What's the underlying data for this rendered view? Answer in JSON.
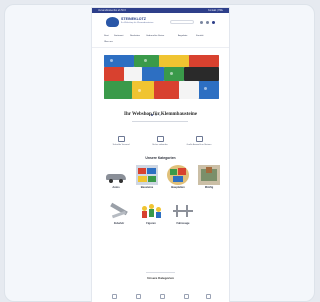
{
  "topbar": {
    "left_text": "Versandkostenfrei ab 50 €",
    "right_text": "Kontakt | Hilfe"
  },
  "brand": {
    "name": "STEINEKLOTZ",
    "tagline": "Ihr Webshop für Klemmbausteine"
  },
  "nav": {
    "items": [
      "Start",
      "Sortiment",
      "Neuheiten",
      "Gebrauchte Steine",
      "Angebote",
      "Kontakt",
      "Über uns"
    ]
  },
  "hero": {
    "slides_total": 3,
    "active_slide": 1,
    "colors": {
      "red": "#d8412f",
      "green": "#3a9a4a",
      "yellow": "#f0c431",
      "blue": "#2d6fc2",
      "white": "#f4f4f4",
      "black": "#2a2a2a"
    }
  },
  "headline": "Ihr Webshop für Klemmbausteine",
  "usps": [
    {
      "icon": "truck-icon",
      "text": "Schneller Versand"
    },
    {
      "icon": "shield-icon",
      "text": "Sicher einkaufen"
    },
    {
      "icon": "box-icon",
      "text": "Große Auswahl an Steinen"
    }
  ],
  "categories_title": "Unsere Kategorien",
  "categories": [
    {
      "label": "Autos"
    },
    {
      "label": "Bausteine"
    },
    {
      "label": "Bauplatten"
    },
    {
      "label": "Minifig"
    },
    {
      "label": "Zubehör"
    },
    {
      "label": "Figuren"
    },
    {
      "label": "Fahrzeuge"
    }
  ],
  "footer": {
    "title": "Unsere Kategorien",
    "icons": [
      "facebook-icon",
      "instagram-icon",
      "mail-icon",
      "phone-icon",
      "info-icon"
    ]
  }
}
